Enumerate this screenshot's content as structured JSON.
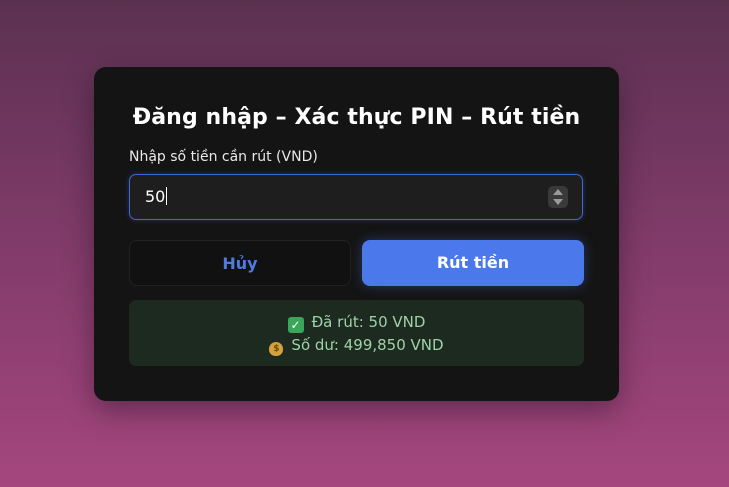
{
  "title": "Đăng nhập – Xác thực PIN – Rút tiền",
  "amount_field": {
    "label": "Nhập số tiền cần rút (VND)",
    "value": "50"
  },
  "buttons": {
    "cancel_label": "Hủy",
    "withdraw_label": "Rút tiền"
  },
  "result": {
    "withdrawn_text": "Đã rút: 50 VND",
    "balance_text": "Số dư: 499,850 VND",
    "withdrawn_icon": "check-icon",
    "balance_icon": "money-bag-icon"
  },
  "colors": {
    "accent": "#4b79ec",
    "card_bg": "#141414",
    "success_text": "#9fd2a8"
  }
}
